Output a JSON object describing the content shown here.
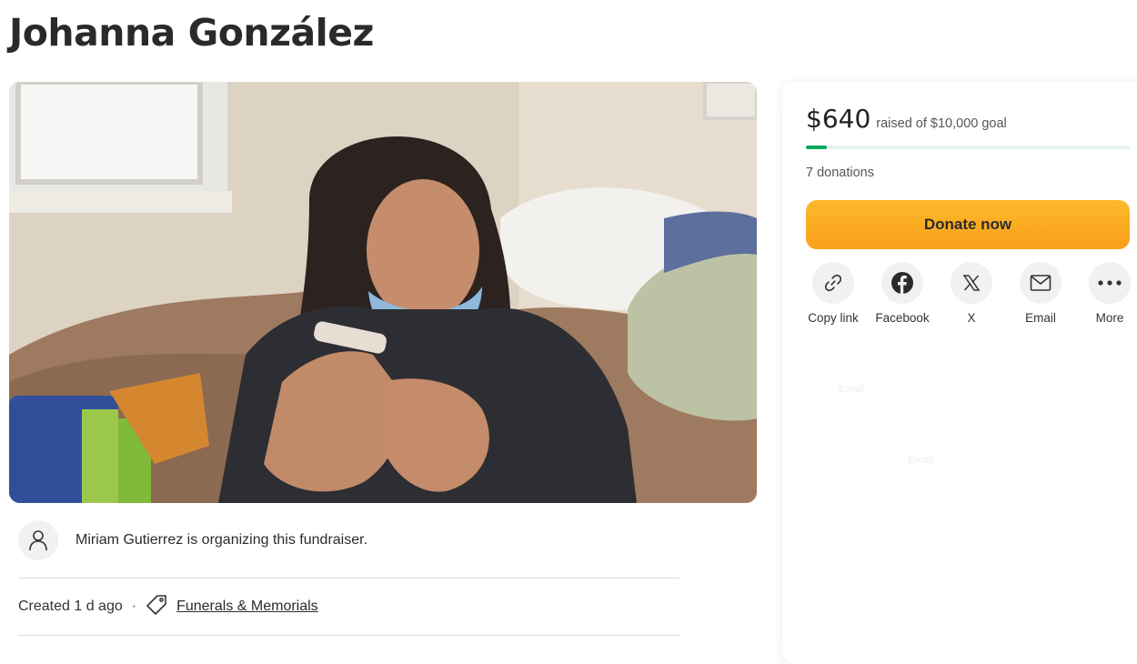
{
  "page": {
    "title": "Johanna González"
  },
  "organizer": {
    "text": "Miriam Gutierrez is organizing this fundraiser."
  },
  "meta": {
    "created": "Created 1 d ago",
    "separator": "·",
    "category": "Funerals & Memorials"
  },
  "campaign": {
    "raised": "$640",
    "goal_text": "raised of $10,000 goal",
    "progress_fraction": 0.064,
    "donations": "7 donations",
    "donate_label": "Donate now"
  },
  "share": [
    {
      "label": "Copy link",
      "icon": "link-icon"
    },
    {
      "label": "Facebook",
      "icon": "facebook-icon"
    },
    {
      "label": "X",
      "icon": "x-logo-icon"
    },
    {
      "label": "Email",
      "icon": "email-icon"
    },
    {
      "label": "More",
      "icon": "more-icon"
    }
  ],
  "ghost": {
    "email_a": "Email",
    "email_b": "Email"
  },
  "colors": {
    "accent_green": "#02a95c",
    "donate_orange": "#fbb02a"
  }
}
